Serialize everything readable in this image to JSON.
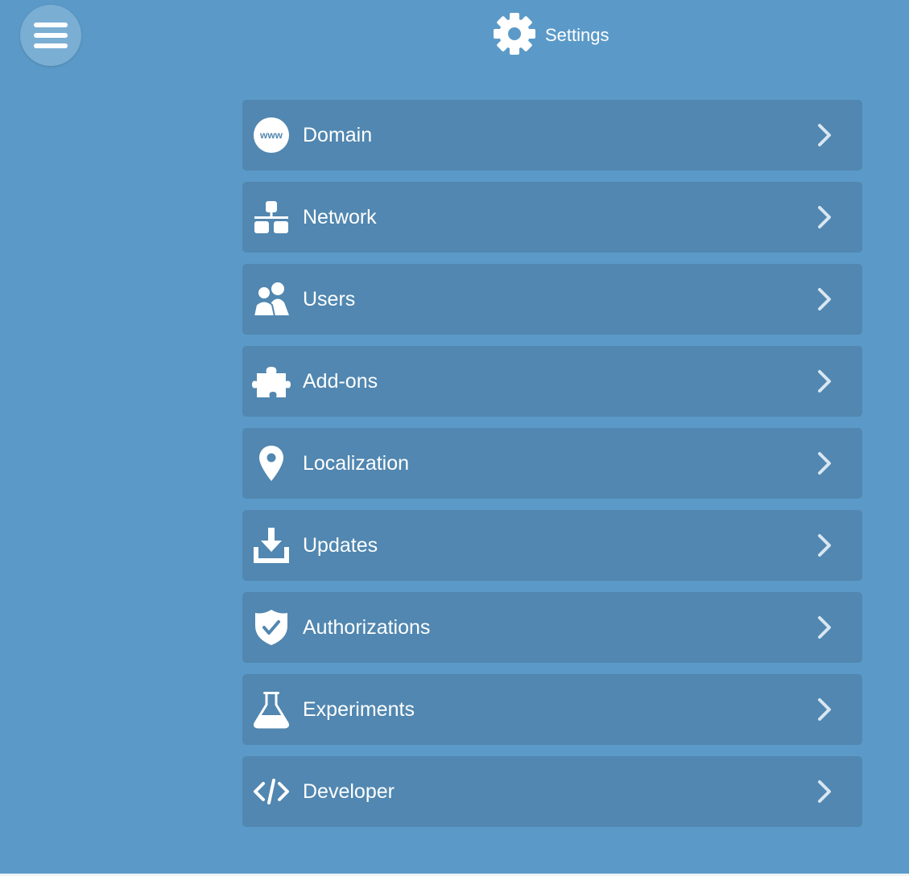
{
  "header": {
    "title": "Settings",
    "icon": "gear-icon"
  },
  "menu": {
    "icon": "hamburger-menu-icon"
  },
  "colors": {
    "background": "#5b9ac8",
    "item_background": "#5187b0",
    "text": "#ffffff"
  },
  "settings_items": [
    {
      "key": "domain",
      "label": "Domain",
      "icon": "www-globe-icon"
    },
    {
      "key": "network",
      "label": "Network",
      "icon": "network-icon"
    },
    {
      "key": "users",
      "label": "Users",
      "icon": "users-icon"
    },
    {
      "key": "addons",
      "label": "Add-ons",
      "icon": "puzzle-piece-icon"
    },
    {
      "key": "localization",
      "label": "Localization",
      "icon": "map-pin-icon"
    },
    {
      "key": "updates",
      "label": "Updates",
      "icon": "download-tray-icon"
    },
    {
      "key": "authorizations",
      "label": "Authorizations",
      "icon": "shield-check-icon"
    },
    {
      "key": "experiments",
      "label": "Experiments",
      "icon": "flask-icon"
    },
    {
      "key": "developer",
      "label": "Developer",
      "icon": "code-icon"
    }
  ]
}
